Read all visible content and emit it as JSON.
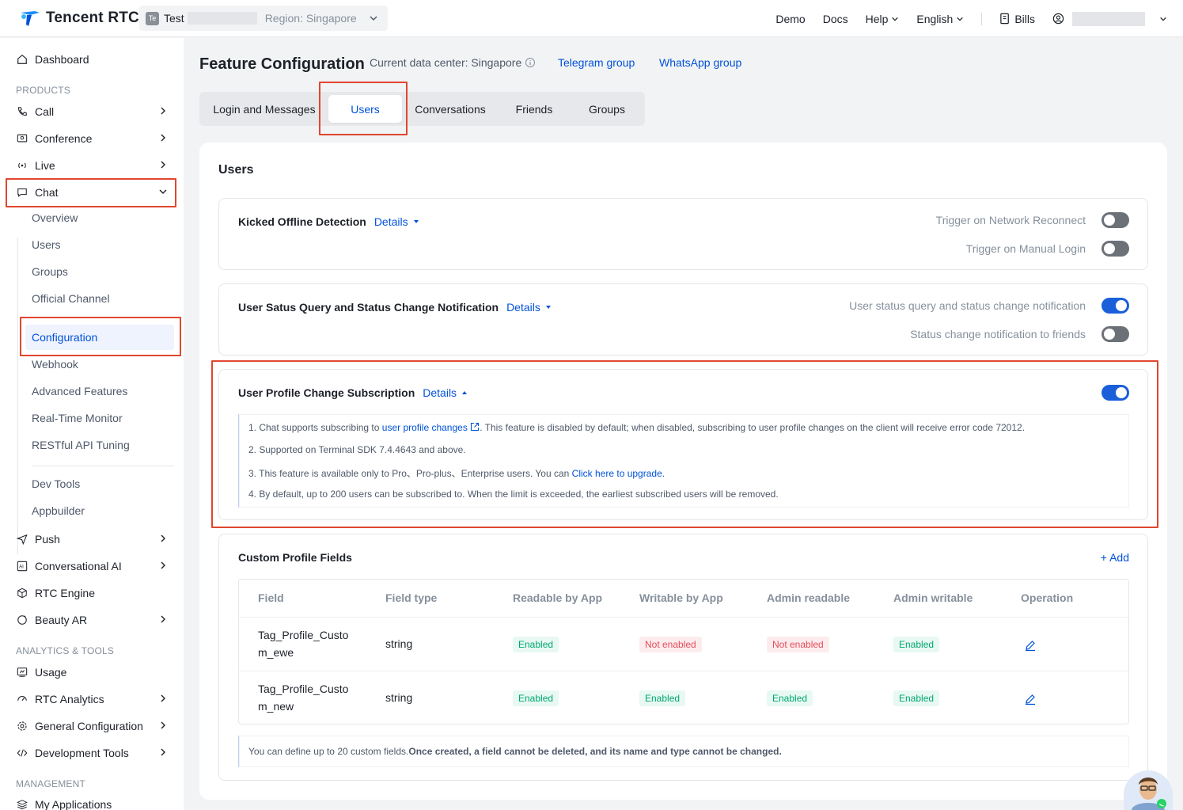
{
  "brand": {
    "name": "Tencent RTC"
  },
  "app_switcher": {
    "badge": "Te",
    "name": "Test",
    "region": "Region: Singapore"
  },
  "topnav": {
    "demo": "Demo",
    "docs": "Docs",
    "help": "Help",
    "language": "English",
    "bills": "Bills"
  },
  "sidebar": {
    "dashboard": "Dashboard",
    "products_section": "PRODUCTS",
    "call": "Call",
    "conference": "Conference",
    "live": "Live",
    "chat": "Chat",
    "chat_children": [
      "Overview",
      "Users",
      "Groups",
      "Official Channel",
      "Configuration",
      "Webhook",
      "Advanced Features",
      "Real-Time Monitor",
      "RESTful API Tuning",
      "Dev Tools",
      "Appbuilder"
    ],
    "push": "Push",
    "conversational_ai": "Conversational AI",
    "rtc_engine": "RTC Engine",
    "beauty_ar": "Beauty AR",
    "analytics_section": "ANALYTICS & TOOLS",
    "usage": "Usage",
    "rtc_analytics": "RTC Analytics",
    "general_configuration": "General Configuration",
    "development_tools": "Development Tools",
    "management_section": "MANAGEMENT",
    "my_applications": "My Applications"
  },
  "page": {
    "title": "Feature Configuration",
    "data_center": "Current data center: Singapore",
    "telegram": "Telegram group",
    "whatsapp": "WhatsApp group"
  },
  "tabs": [
    "Login and Messages",
    "Users",
    "Conversations",
    "Friends",
    "Groups"
  ],
  "section_title": "Users",
  "features": {
    "kicked": {
      "title": "Kicked Offline Detection",
      "details": "Details",
      "toggle1": "Trigger on Network Reconnect",
      "toggle2": "Trigger on Manual Login"
    },
    "status": {
      "title": "User Satus Query and Status Change Notification",
      "details": "Details",
      "toggle1": "User status query and status change notification",
      "toggle2": "Status change notification to friends"
    },
    "profile": {
      "title": "User Profile Change Subscription",
      "details": "Details",
      "note1_a": "1. Chat supports subscribing to ",
      "note1_link": "user profile changes",
      "note1_b": ". This feature is disabled by default; when disabled, subscribing to user profile changes on the client will receive error code 72012.",
      "note2": "2. Supported on Terminal SDK 7.4.4643 and above.",
      "note3_a": "3. This feature is available only to Pro、Pro-plus、Enterprise users. You can ",
      "note3_link": "Click here to upgrade",
      "note3_b": ".",
      "note4": "4. By default, up to 200 users can be subscribed to. When the limit is exceeded, the earliest subscribed users will be removed."
    },
    "custom": {
      "title": "Custom Profile Fields",
      "add": "+ Add",
      "columns": [
        "Field",
        "Field type",
        "Readable by App",
        "Writable by App",
        "Admin readable",
        "Admin writable",
        "Operation"
      ],
      "rows": [
        {
          "field_l1": "Tag_Profile_Custo",
          "field_l2": "m_ewe",
          "type": "string",
          "readable": "Enabled",
          "writable": "Not enabled",
          "admin_readable": "Not enabled",
          "admin_writable": "Enabled"
        },
        {
          "field_l1": "Tag_Profile_Custo",
          "field_l2": "m_new",
          "type": "string",
          "readable": "Enabled",
          "writable": "Enabled",
          "admin_readable": "Enabled",
          "admin_writable": "Enabled"
        }
      ],
      "tip_a": "You can define up to 20 custom fields.",
      "tip_b": "Once created, a field cannot be deleted, and its name and type cannot be changed."
    }
  },
  "colors": {
    "accent": "#0052d9",
    "highlight": "#e0462e",
    "enabled": "#00a870",
    "not_enabled": "#e34d59"
  }
}
